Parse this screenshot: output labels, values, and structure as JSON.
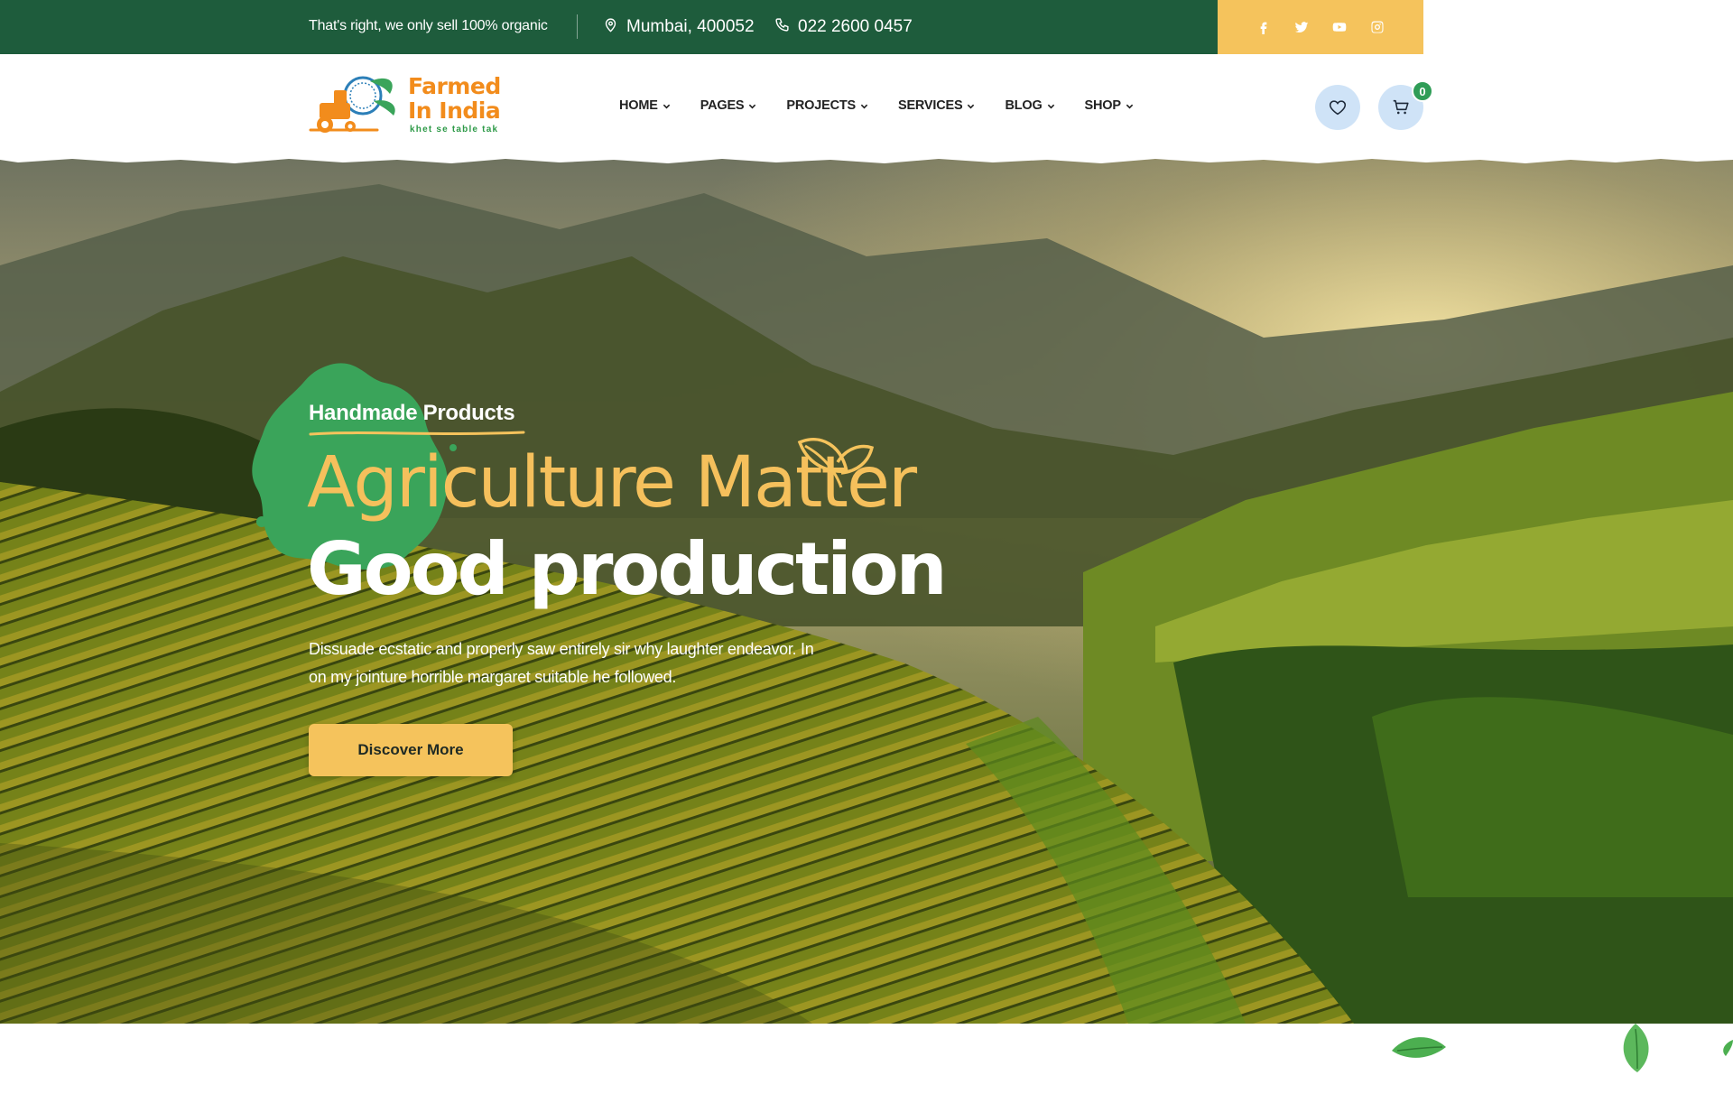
{
  "topbar": {
    "tagline": "That's right, we only sell 100% organic",
    "location": "Mumbai, 400052",
    "phone": "022 2600 0457",
    "social": [
      "facebook-icon",
      "twitter-icon",
      "youtube-icon",
      "instagram-icon"
    ]
  },
  "brand": {
    "line1": "Farmed",
    "line2": "In India",
    "tagline": "khet se table tak"
  },
  "nav": {
    "items": [
      {
        "label": "HOME"
      },
      {
        "label": "PAGES"
      },
      {
        "label": "PROJECTS"
      },
      {
        "label": "SERVICES"
      },
      {
        "label": "BLOG"
      },
      {
        "label": "SHOP"
      }
    ]
  },
  "header_actions": {
    "cart_count": "0"
  },
  "hero": {
    "eyebrow": "Handmade Products",
    "headline1": "Agriculture Matter",
    "headline2": "Good production",
    "description": "Dissuade ecstatic and properly saw entirely sir why laughter endeavor. In on my jointure horrible margaret suitable he followed.",
    "cta": "Discover More"
  },
  "colors": {
    "topbar_green": "#1e5c3c",
    "accent_yellow": "#f5c35c",
    "brand_orange": "#f28c1c",
    "splash_green": "#3aa45a",
    "badge_green": "#2f9d57"
  }
}
